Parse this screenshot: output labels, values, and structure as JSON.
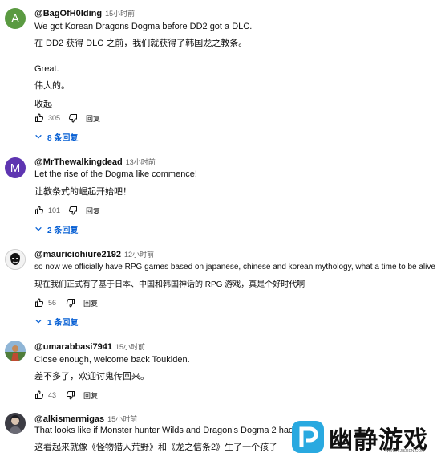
{
  "comments": [
    {
      "author": "@BagOfH0lding",
      "time": "15小时前",
      "avatar_letter": "A",
      "avatar_color": "#5a9a41",
      "lines": [
        "We got Korean Dragons Dogma before DD2 got a DLC.",
        "在 DD2 获得 DLC 之前，我们就获得了韩国龙之教条。",
        "Great.",
        "伟大的。",
        "收起"
      ],
      "likes": "305",
      "reply_label": "回复",
      "replies_label": "8 条回复"
    },
    {
      "author": "@MrThewalkingdead",
      "time": "13小时前",
      "avatar_letter": "M",
      "avatar_color": "#5e35b1",
      "lines": [
        "Let the rise of the Dogma like commence!",
        "让教条式的崛起开始吧！"
      ],
      "likes": "101",
      "reply_label": "回复",
      "replies_label": "2 条回复"
    },
    {
      "author": "@mauriciohiure2192",
      "time": "12小时前",
      "lines": [
        "so now we officially have RPG games based on japanese, chinese and korean mythology, what a time to be alive",
        "现在我们正式有了基于日本、中国和韩国神话的 RPG 游戏，真是个好时代啊"
      ],
      "likes": "56",
      "reply_label": "回复",
      "replies_label": "1 条回复"
    },
    {
      "author": "@umarabbasi7941",
      "time": "15小时前",
      "lines": [
        "Close enough, welcome back Toukiden.",
        "差不多了，欢迎讨鬼传回来。"
      ],
      "likes": "43",
      "reply_label": "回复"
    },
    {
      "author": "@alkismermigas",
      "time": "15小时前",
      "lines": [
        "That looks like if Monster hunter Wilds and Dragon's Dogma 2 had a chil",
        "这看起来就像《怪物猎人荒野》和《龙之信条2》生了一个孩子"
      ]
    }
  ],
  "watermark": {
    "text": "幽静游戏",
    "url": "WWW.YJISREN.COM"
  }
}
